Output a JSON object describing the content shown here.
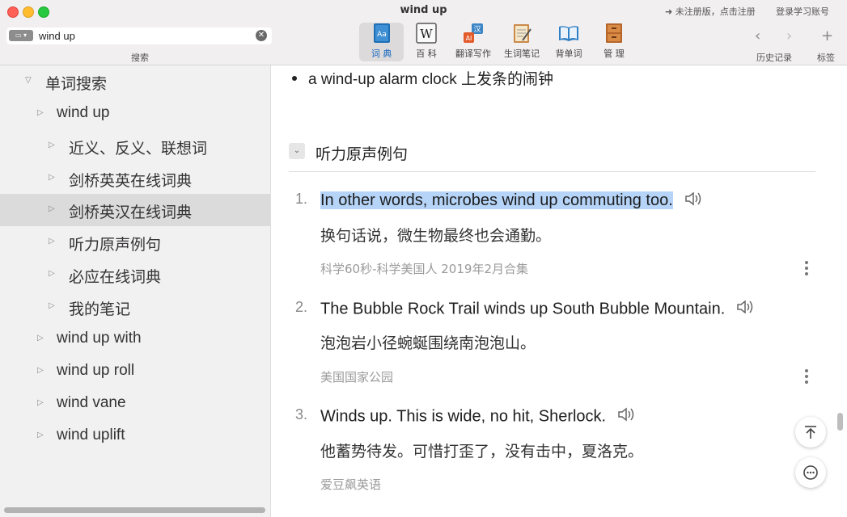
{
  "window": {
    "title": "wind up",
    "register_link": "➜ 未注册版，点击注册",
    "login_link": "登录学习账号"
  },
  "search": {
    "value": "wind up",
    "caption": "搜索",
    "clear_icon": "close-circle-icon"
  },
  "toolbar": {
    "tools": [
      {
        "label": "词 典",
        "icon": "dictionary-icon",
        "active": true
      },
      {
        "label": "百 科",
        "icon": "wikipedia-icon",
        "active": false
      },
      {
        "label": "翻译写作",
        "icon": "translate-icon",
        "active": false
      },
      {
        "label": "生词笔记",
        "icon": "notebook-icon",
        "active": false
      },
      {
        "label": "背单词",
        "icon": "book-icon",
        "active": false
      },
      {
        "label": "管 理",
        "icon": "cabinet-icon",
        "active": false
      }
    ],
    "history_label": "历史记录",
    "bookmark_label": "标签",
    "back_symbol": "‹",
    "forward_symbol": "›",
    "add_symbol": "+"
  },
  "sidebar": {
    "items": [
      {
        "label": "单词搜索",
        "expanded": true
      },
      {
        "label": "wind up"
      },
      {
        "label": "近义、反义、联想词"
      },
      {
        "label": "剑桥英英在线词典"
      },
      {
        "label": "剑桥英汉在线词典",
        "selected": true
      },
      {
        "label": "听力原声例句"
      },
      {
        "label": "必应在线词典"
      },
      {
        "label": "我的笔记"
      },
      {
        "label": "wind up with"
      },
      {
        "label": "wind up roll"
      },
      {
        "label": "wind vane"
      },
      {
        "label": "wind uplift"
      }
    ]
  },
  "content": {
    "bullet": "a wind-up alarm clock 上发条的闹钟",
    "section_title": "听力原声例句",
    "examples": [
      {
        "num": "1.",
        "en": "In other words, microbes wind up commuting too.",
        "zh": "换句话说，微生物最终也会通勤。",
        "source": "科学60秒-科学美国人 2019年2月合集"
      },
      {
        "num": "2.",
        "en": "The Bubble Rock Trail winds up South Bubble Mountain.",
        "zh": "泡泡岩小径蜿蜒围绕南泡泡山。",
        "source": "美国国家公园"
      },
      {
        "num": "3.",
        "en": "Winds up. This is wide, no hit, Sherlock.",
        "zh": "他蓄势待发。可惜打歪了，没有击中，夏洛克。",
        "source": "爱豆飙英语"
      }
    ]
  },
  "colors": {
    "accent": "#1565c0",
    "highlight": "#b5d4f8"
  }
}
